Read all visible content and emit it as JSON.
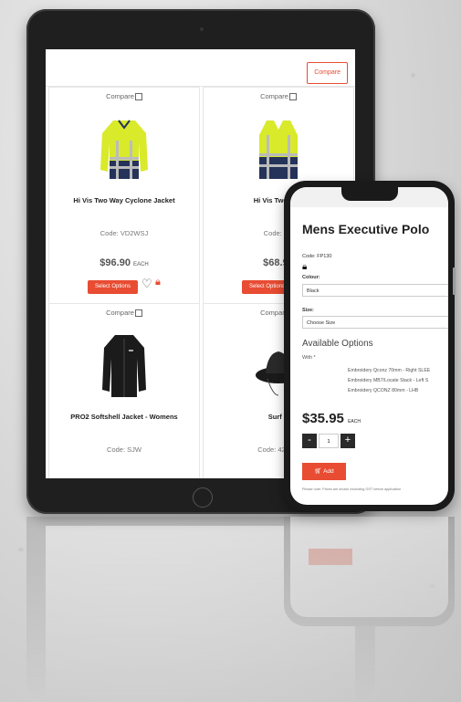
{
  "tablet": {
    "compare_button": "Compare",
    "products": [
      {
        "compare": "Compare",
        "name": "Hi Vis Two Way Cyclone Jacket",
        "code": "Code: VD2WSJ",
        "price": "$96.90",
        "unit": "EACH",
        "button": "Select Options"
      },
      {
        "compare": "Compare",
        "name": "Hi Vis Two Way",
        "code": "Code: VD",
        "price": "$68.90",
        "unit": "",
        "button": "Select Options"
      },
      {
        "compare": "Compare",
        "name": "PRO2 Softshell Jacket - Womens",
        "code": "Code: SJW",
        "price": "",
        "unit": "",
        "button": ""
      },
      {
        "compare": "Compare",
        "name": "Surf H",
        "code": "Code: 4287-5",
        "price": "",
        "unit": "",
        "button": ""
      }
    ]
  },
  "phone": {
    "title": "Mens Executive Polo",
    "code": "Code: FP130",
    "colour_label": "Colour:",
    "colour_value": "Black",
    "size_label": "Size:",
    "size_value": "Choose Size",
    "available_title": "Available Options",
    "with_label": "With *",
    "options": [
      "Embroidery Qconz 70mm - Right SLEE",
      "Embroidery MB7/Locate Stack - Left S",
      "Embroidery QCONZ 80mm - LHB"
    ],
    "price": "$35.95",
    "price_unit": "EACH",
    "qty_minus": "-",
    "qty_value": "1",
    "qty_plus": "+",
    "add_label": "Add",
    "note": "Please note: Prices are shown excluding GST before application"
  },
  "colors": {
    "accent": "#e84c32",
    "dark": "#2a2a2a"
  }
}
